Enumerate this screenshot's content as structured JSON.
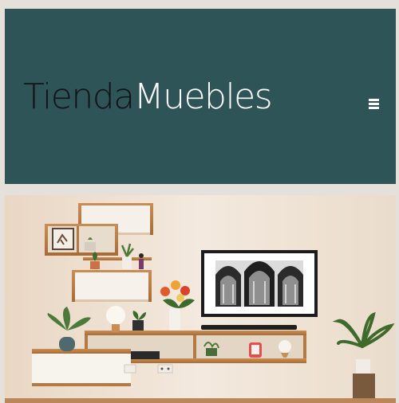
{
  "header": {
    "logo": {
      "word1": "Tienda",
      "word2": "Muebles"
    },
    "menu_icon": "hamburger-menu-icon",
    "background_color": "#2e5458"
  },
  "hero": {
    "image": "living-room-wall-with-floating-shelves-and-framed-cathedral-art"
  }
}
